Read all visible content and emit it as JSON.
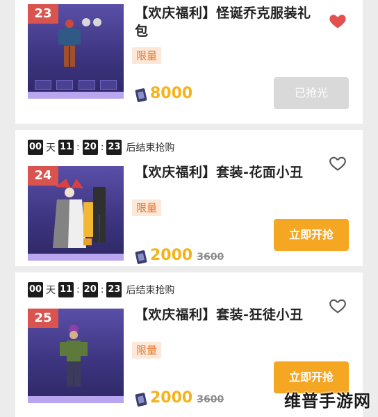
{
  "items": [
    {
      "num": "23",
      "title": "【欢庆福利】怪诞乔克服装礼包",
      "tag": "限量",
      "price": "8000",
      "old_price": "",
      "button": "已抢光",
      "favorited": true
    },
    {
      "num": "24",
      "timer": {
        "d": "00",
        "day_unit": "天",
        "h": "11",
        "m": "20",
        "s": "23",
        "suffix": "后结束抢购"
      },
      "title": "【欢庆福利】套装-花面小丑",
      "tag": "限量",
      "price": "2000",
      "old_price": "3600",
      "button": "立即开抢",
      "favorited": false
    },
    {
      "num": "25",
      "timer": {
        "d": "00",
        "day_unit": "天",
        "h": "11",
        "m": "20",
        "s": "23",
        "suffix": "后结束抢购"
      },
      "title": "【欢庆福利】套装-狂徒小丑",
      "tag": "限量",
      "price": "2000",
      "old_price": "3600",
      "button": "立即开抢",
      "favorited": false
    }
  ],
  "watermark": "维普手游网",
  "colors": {
    "accent": "#f5a623",
    "price": "#f5b21a",
    "badge": "#d9534f",
    "heart": "#e35050",
    "tag_bg": "#fde8d8",
    "tag_text": "#e8762d"
  },
  "icons": {
    "heart_filled": "heart-filled-icon",
    "heart_outline": "heart-outline-icon",
    "coin": "diamond-coin-icon"
  }
}
